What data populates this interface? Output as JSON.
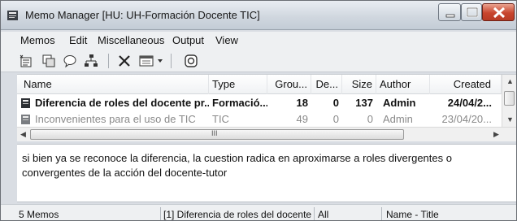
{
  "window": {
    "title": "Memo Manager [HU: UH-Formación Docente TIC]"
  },
  "menubar": {
    "items": [
      "Memos",
      "Edit",
      "Miscellaneous",
      "Output",
      "View"
    ]
  },
  "toolbar": {
    "icons": [
      "new-memo-icon",
      "copy-memo-icon",
      "comment-icon",
      "tree-icon",
      "delete-icon",
      "view-options-icon",
      "dropdown-arrow-icon",
      "refresh-icon"
    ]
  },
  "table": {
    "columns": [
      "Name",
      "Type",
      "Grou...",
      "De...",
      "Size",
      "Author",
      "Created"
    ],
    "rows": [
      {
        "name": "Diferencia de roles del docente pr...",
        "type": "Formació...",
        "groups": "18",
        "density": "0",
        "size": "137",
        "author": "Admin",
        "created": "24/04/2...",
        "selected": true
      },
      {
        "name": "Inconvenientes para el uso de TIC",
        "type": "TIC",
        "groups": "49",
        "density": "0",
        "size": "0",
        "author": "Admin",
        "created": "23/04/20...",
        "selected": false
      }
    ],
    "hscroll_grip": "III"
  },
  "memo_text": "si bien ya se reconoce la diferencia, la cuestion radica en aproximarse a roles divergentes o convergentes de la acción del docente-tutor",
  "statusbar": {
    "count": "5 Memos",
    "current": "[1] Diferencia de roles del docente",
    "filter": "All",
    "sort": "Name - Title"
  }
}
